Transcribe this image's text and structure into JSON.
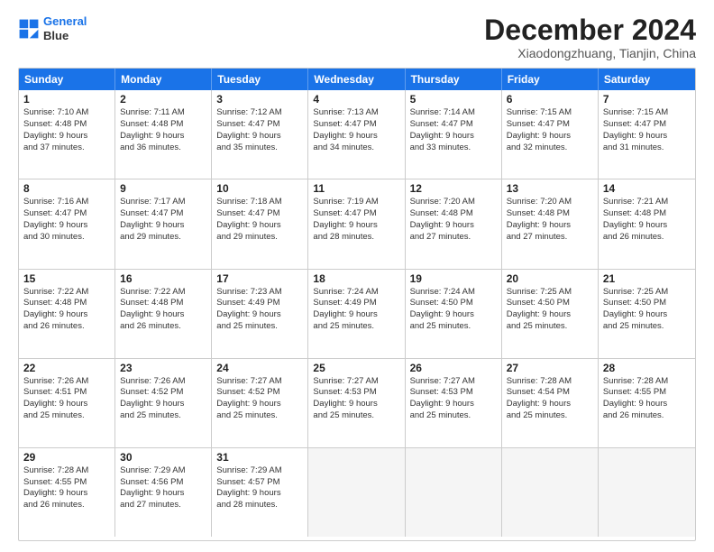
{
  "logo": {
    "line1": "General",
    "line2": "Blue"
  },
  "title": "December 2024",
  "subtitle": "Xiaodongzhuang, Tianjin, China",
  "days": [
    "Sunday",
    "Monday",
    "Tuesday",
    "Wednesday",
    "Thursday",
    "Friday",
    "Saturday"
  ],
  "weeks": [
    [
      {
        "day": "1",
        "info": "Sunrise: 7:10 AM\nSunset: 4:48 PM\nDaylight: 9 hours\nand 37 minutes."
      },
      {
        "day": "2",
        "info": "Sunrise: 7:11 AM\nSunset: 4:48 PM\nDaylight: 9 hours\nand 36 minutes."
      },
      {
        "day": "3",
        "info": "Sunrise: 7:12 AM\nSunset: 4:47 PM\nDaylight: 9 hours\nand 35 minutes."
      },
      {
        "day": "4",
        "info": "Sunrise: 7:13 AM\nSunset: 4:47 PM\nDaylight: 9 hours\nand 34 minutes."
      },
      {
        "day": "5",
        "info": "Sunrise: 7:14 AM\nSunset: 4:47 PM\nDaylight: 9 hours\nand 33 minutes."
      },
      {
        "day": "6",
        "info": "Sunrise: 7:15 AM\nSunset: 4:47 PM\nDaylight: 9 hours\nand 32 minutes."
      },
      {
        "day": "7",
        "info": "Sunrise: 7:15 AM\nSunset: 4:47 PM\nDaylight: 9 hours\nand 31 minutes."
      }
    ],
    [
      {
        "day": "8",
        "info": "Sunrise: 7:16 AM\nSunset: 4:47 PM\nDaylight: 9 hours\nand 30 minutes."
      },
      {
        "day": "9",
        "info": "Sunrise: 7:17 AM\nSunset: 4:47 PM\nDaylight: 9 hours\nand 29 minutes."
      },
      {
        "day": "10",
        "info": "Sunrise: 7:18 AM\nSunset: 4:47 PM\nDaylight: 9 hours\nand 29 minutes."
      },
      {
        "day": "11",
        "info": "Sunrise: 7:19 AM\nSunset: 4:47 PM\nDaylight: 9 hours\nand 28 minutes."
      },
      {
        "day": "12",
        "info": "Sunrise: 7:20 AM\nSunset: 4:48 PM\nDaylight: 9 hours\nand 27 minutes."
      },
      {
        "day": "13",
        "info": "Sunrise: 7:20 AM\nSunset: 4:48 PM\nDaylight: 9 hours\nand 27 minutes."
      },
      {
        "day": "14",
        "info": "Sunrise: 7:21 AM\nSunset: 4:48 PM\nDaylight: 9 hours\nand 26 minutes."
      }
    ],
    [
      {
        "day": "15",
        "info": "Sunrise: 7:22 AM\nSunset: 4:48 PM\nDaylight: 9 hours\nand 26 minutes."
      },
      {
        "day": "16",
        "info": "Sunrise: 7:22 AM\nSunset: 4:48 PM\nDaylight: 9 hours\nand 26 minutes."
      },
      {
        "day": "17",
        "info": "Sunrise: 7:23 AM\nSunset: 4:49 PM\nDaylight: 9 hours\nand 25 minutes."
      },
      {
        "day": "18",
        "info": "Sunrise: 7:24 AM\nSunset: 4:49 PM\nDaylight: 9 hours\nand 25 minutes."
      },
      {
        "day": "19",
        "info": "Sunrise: 7:24 AM\nSunset: 4:50 PM\nDaylight: 9 hours\nand 25 minutes."
      },
      {
        "day": "20",
        "info": "Sunrise: 7:25 AM\nSunset: 4:50 PM\nDaylight: 9 hours\nand 25 minutes."
      },
      {
        "day": "21",
        "info": "Sunrise: 7:25 AM\nSunset: 4:50 PM\nDaylight: 9 hours\nand 25 minutes."
      }
    ],
    [
      {
        "day": "22",
        "info": "Sunrise: 7:26 AM\nSunset: 4:51 PM\nDaylight: 9 hours\nand 25 minutes."
      },
      {
        "day": "23",
        "info": "Sunrise: 7:26 AM\nSunset: 4:52 PM\nDaylight: 9 hours\nand 25 minutes."
      },
      {
        "day": "24",
        "info": "Sunrise: 7:27 AM\nSunset: 4:52 PM\nDaylight: 9 hours\nand 25 minutes."
      },
      {
        "day": "25",
        "info": "Sunrise: 7:27 AM\nSunset: 4:53 PM\nDaylight: 9 hours\nand 25 minutes."
      },
      {
        "day": "26",
        "info": "Sunrise: 7:27 AM\nSunset: 4:53 PM\nDaylight: 9 hours\nand 25 minutes."
      },
      {
        "day": "27",
        "info": "Sunrise: 7:28 AM\nSunset: 4:54 PM\nDaylight: 9 hours\nand 25 minutes."
      },
      {
        "day": "28",
        "info": "Sunrise: 7:28 AM\nSunset: 4:55 PM\nDaylight: 9 hours\nand 26 minutes."
      }
    ],
    [
      {
        "day": "29",
        "info": "Sunrise: 7:28 AM\nSunset: 4:55 PM\nDaylight: 9 hours\nand 26 minutes."
      },
      {
        "day": "30",
        "info": "Sunrise: 7:29 AM\nSunset: 4:56 PM\nDaylight: 9 hours\nand 27 minutes."
      },
      {
        "day": "31",
        "info": "Sunrise: 7:29 AM\nSunset: 4:57 PM\nDaylight: 9 hours\nand 28 minutes."
      },
      {
        "day": "",
        "info": ""
      },
      {
        "day": "",
        "info": ""
      },
      {
        "day": "",
        "info": ""
      },
      {
        "day": "",
        "info": ""
      }
    ]
  ]
}
